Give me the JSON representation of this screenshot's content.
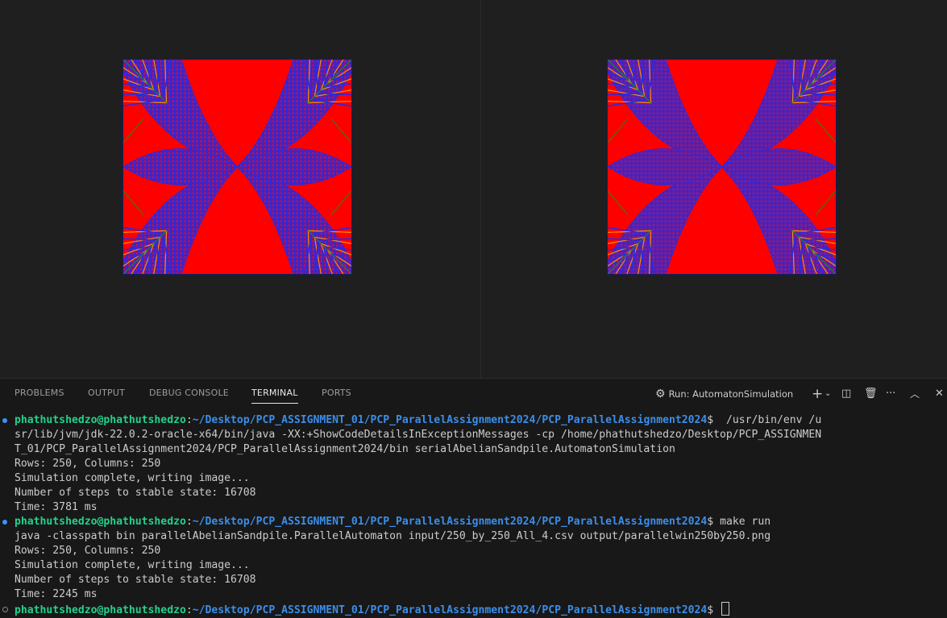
{
  "panel": {
    "tabs": [
      "PROBLEMS",
      "OUTPUT",
      "DEBUG CONSOLE",
      "TERMINAL",
      "PORTS"
    ],
    "active_tab": "TERMINAL",
    "run_label": "Run: AutomatonSimulation",
    "icons": [
      "gear-icon",
      "plus-icon",
      "chevron-down-icon",
      "split-terminal-icon",
      "trash-icon",
      "more-icon",
      "chevron-up-icon",
      "close-icon"
    ]
  },
  "terminal": {
    "user": "phathutshedzo@phathutshedzo",
    "sep": ":",
    "path": "~/Desktop/PCP_ASSIGNMENT_01/PCP_ParallelAssignment2024/PCP_ParallelAssignment2024",
    "prompt": "$",
    "cmd1": "  /usr/bin/env /u",
    "cmd1_cont1": "sr/lib/jvm/jdk-22.0.2-oracle-x64/bin/java -XX:+ShowCodeDetailsInExceptionMessages -cp /home/phathutshedzo/Desktop/PCP_ASSIGNMEN",
    "cmd1_cont2": "T_01/PCP_ParallelAssignment2024/PCP_ParallelAssignment2024/bin serialAbelianSandpile.AutomatonSimulation",
    "out1_rows": "Rows: 250, Columns: 250",
    "out1_complete": "Simulation complete, writing image...",
    "out1_steps": "Number of steps to stable state: 16708",
    "out1_time": "Time: 3781 ms",
    "cmd2": " make run",
    "cmd2_echo": "java -classpath bin parallelAbelianSandpile.ParallelAutomaton input/250_by_250_All_4.csv output/parallelwin250by250.png",
    "out2_rows": "Rows: 250, Columns: 250",
    "out2_complete": "Simulation complete, writing image...",
    "out2_steps": "Number of steps to stable state: 16708",
    "out2_time": "Time: 2245 ms"
  },
  "colors": {
    "sand_red": "#ff0000",
    "sand_blue": "#2a2ae0",
    "sand_orange": "#ff8c00",
    "sand_green": "#1e8a1e"
  }
}
